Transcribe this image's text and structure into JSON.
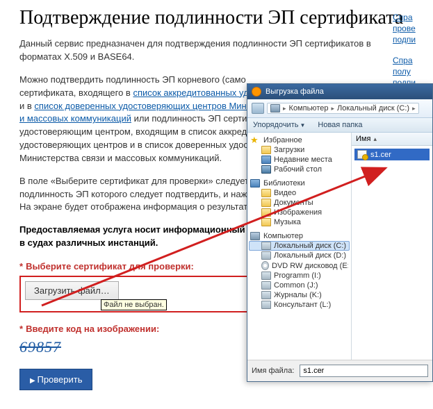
{
  "heading": "Подтверждение подлинности ЭП сертификата",
  "intro": "Данный сервис предназначен для подтверждения подлинности ЭП сертификатов в форматах X.509 и BASE64.",
  "para2_a": "Можно подтвердить подлинность ЭП корневого (само",
  "para2_b": "сертификата, входящего в ",
  "link_accred": "список аккредитованных удо",
  "para2_c": "и в ",
  "link_trusted": "список доверенных удостоверяющих центров Минис",
  "link_masscom": "и массовых коммуникаций",
  "para2_d": " или подлинность ЭП сертиф",
  "para2_e": "удостоверяющим центром, входящим в список аккреди",
  "para2_f": "удостоверяющих центров и в список доверенных удост",
  "para2_g": "Министерства связи и массовых коммуникаций.",
  "para3_a": "В поле «Выберите сертификат для проверки» следует",
  "para3_b": "подлинность ЭП которого следует подтвердить, и наж",
  "para3_c": "На экране будет отображена информация о результата",
  "bold_notice": "Предоставляемая услуга носит информационный х\nв судах различных инстанций.",
  "label_select_cert": "Выберите сертификат для проверки:",
  "btn_upload": "Загрузить файл…",
  "tooltip_nofile": "Файл не выбран.",
  "label_captcha": "Введите код на изображении:",
  "captcha_value": "69857",
  "btn_submit": "Проверить",
  "rlinks": {
    "a": "Спра",
    "b": "прове",
    "c": "подпи",
    "d": "Спра",
    "e": "полу",
    "f": "подпи"
  },
  "dialog": {
    "title": "Выгрузка файла",
    "crumb_computer": "Компьютер",
    "crumb_drive": "Локальный диск (C:)",
    "tool_org": "Упорядочить",
    "tool_new": "Новая папка",
    "tree": {
      "fav": "Избранное",
      "downloads": "Загрузки",
      "recent": "Недавние места",
      "desktop": "Рабочий стол",
      "libs": "Библиотеки",
      "video": "Видео",
      "docs": "Документы",
      "images": "Изображения",
      "music": "Музыка",
      "computer": "Компьютер",
      "c": "Локальный диск (C:)",
      "d": "Локальный диск (D:)",
      "dvd": "DVD RW дисковод (E:) Sin",
      "prog": "Programm (I:)",
      "common": "Common (J:)",
      "journals": "Журналы (K:)",
      "consult": "Консультант (L:)"
    },
    "col_name": "Имя",
    "file_s1": "s1.cer",
    "fn_label": "Имя файла:",
    "fn_value": "s1.cer"
  }
}
